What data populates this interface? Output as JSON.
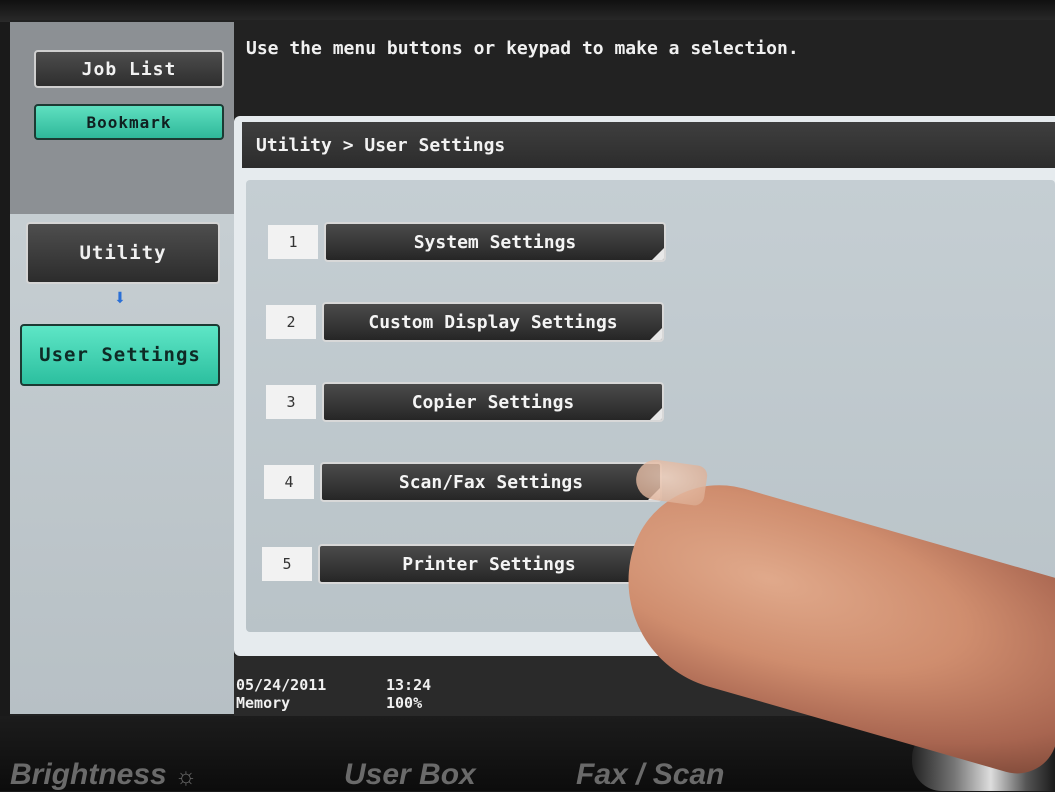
{
  "header": {
    "message": "Use the menu buttons or keypad to make a selection."
  },
  "sidebar": {
    "job_list": "Job List",
    "bookmark": "Bookmark",
    "utility": "Utility",
    "user_settings": "User Settings",
    "arrow_icon": "arrow-down-icon"
  },
  "main": {
    "breadcrumb": "Utility > User Settings",
    "menu": [
      {
        "num": "1",
        "label": "System Settings"
      },
      {
        "num": "2",
        "label": "Custom Display Settings"
      },
      {
        "num": "3",
        "label": "Copier Settings"
      },
      {
        "num": "4",
        "label": "Scan/Fax Settings"
      },
      {
        "num": "5",
        "label": "Printer Settings"
      }
    ]
  },
  "footer": {
    "date": "05/24/2011",
    "time": "13:24",
    "memory_label": "Memory",
    "memory_value": "100%"
  },
  "hardware": {
    "brightness": "Brightness",
    "user_box": "User Box",
    "fax_scan": "Fax / Scan",
    "brightness_icon": "sun-icon"
  },
  "colors": {
    "accent_teal": "#3ccfae",
    "button_dark": "#333333",
    "panel_bg": "#c2ccd1"
  }
}
